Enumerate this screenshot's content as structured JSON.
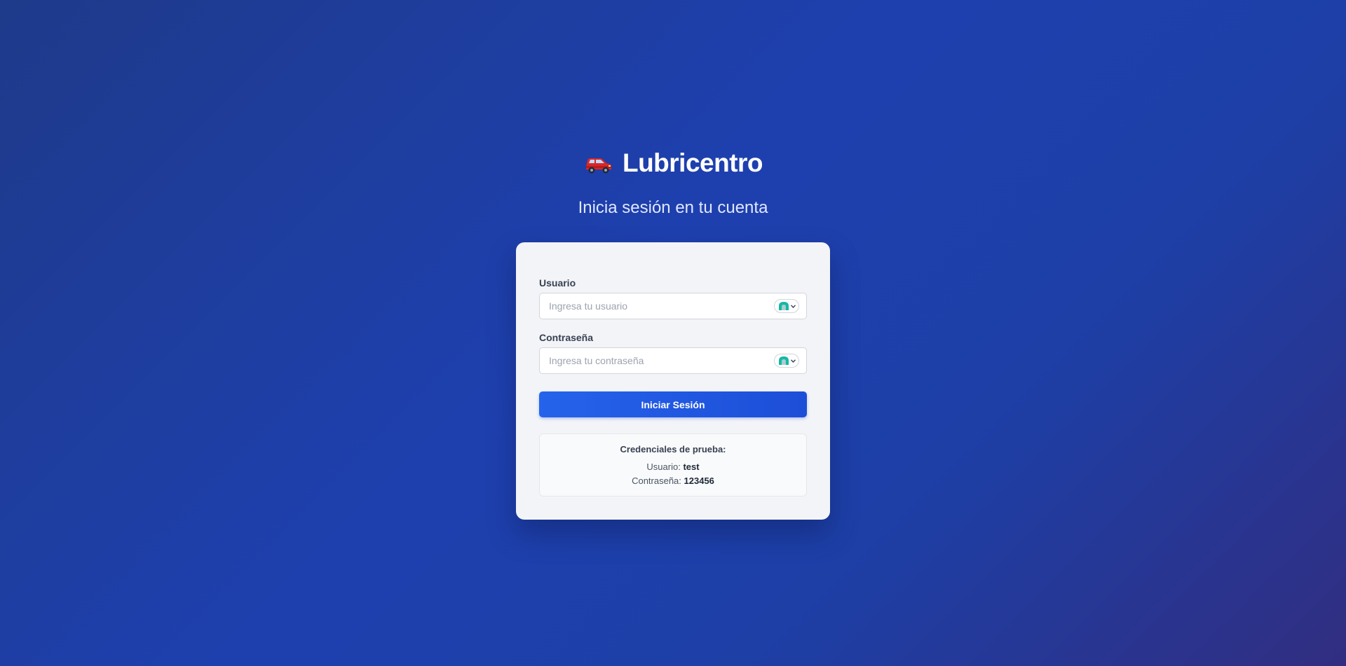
{
  "brand": {
    "icon": "car-icon",
    "title": "Lubricentro"
  },
  "subtitle": "Inicia sesión en tu cuenta",
  "form": {
    "username": {
      "label": "Usuario",
      "placeholder": "Ingresa tu usuario",
      "value": ""
    },
    "password": {
      "label": "Contraseña",
      "placeholder": "Ingresa tu contraseña",
      "value": ""
    },
    "submit_label": "Iniciar Sesión",
    "password_manager_icon": "password-manager-icon"
  },
  "test_credentials": {
    "title": "Credenciales de prueba:",
    "username_label": "Usuario:",
    "username_value": "test",
    "password_label": "Contraseña:",
    "password_value": "123456"
  },
  "colors": {
    "background_start": "#1e3a8a",
    "background_end": "#312e81",
    "primary": "#2563eb",
    "card": "#f3f4f8",
    "password_manager_accent": "#14b8a6"
  }
}
